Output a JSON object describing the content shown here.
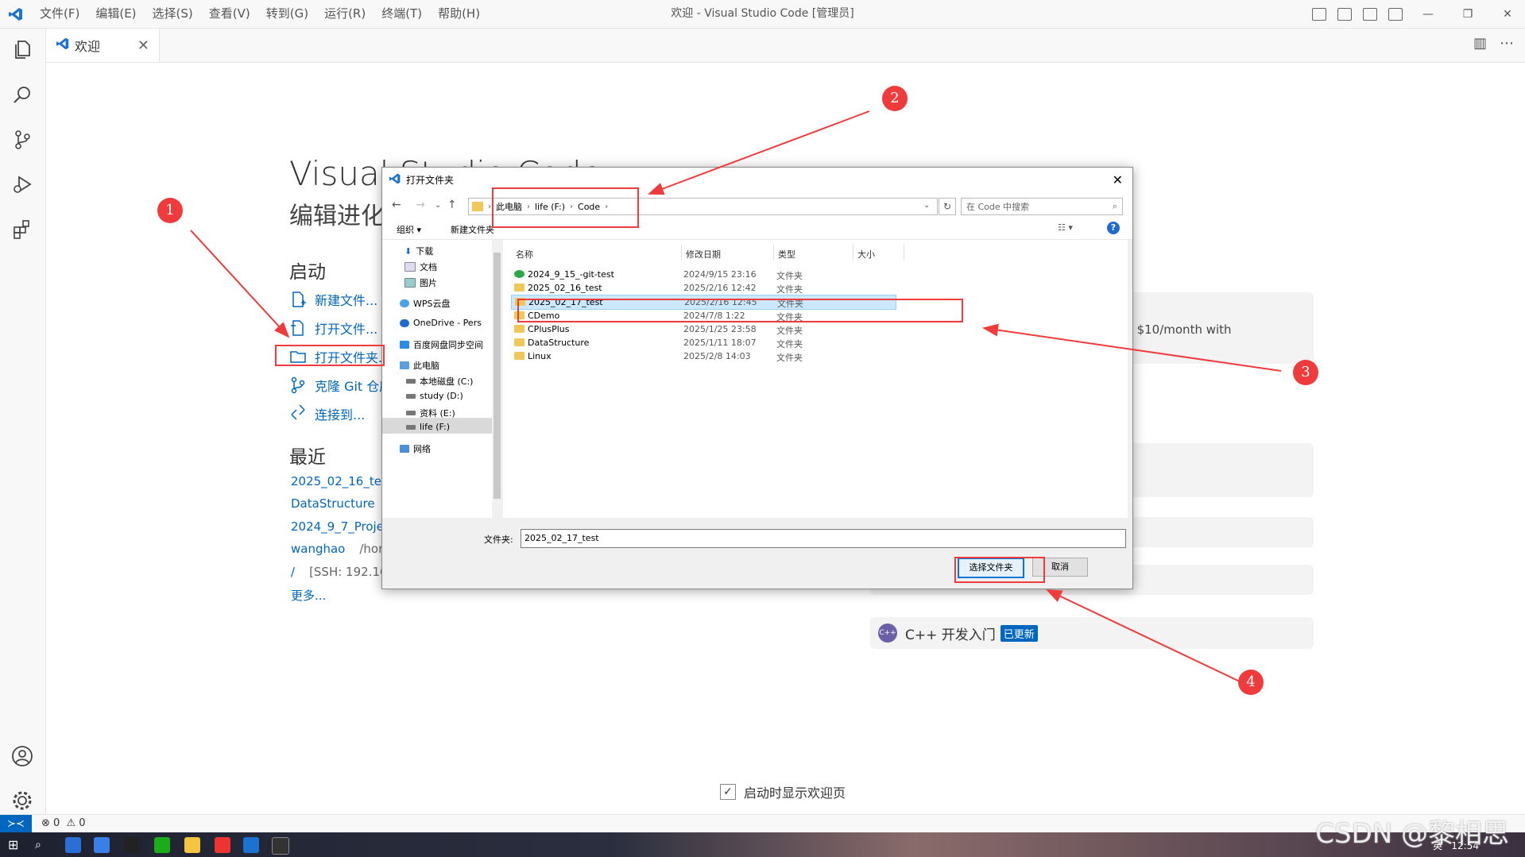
{
  "window": {
    "title": "欢迎 - Visual Studio Code [管理员]",
    "menu": [
      "文件(F)",
      "编辑(E)",
      "选择(S)",
      "查看(V)",
      "转到(G)",
      "运行(R)",
      "终端(T)",
      "帮助(H)"
    ]
  },
  "tab": {
    "label": "欢迎",
    "close": "✕"
  },
  "welcome": {
    "title": "Visual Studio Code",
    "subtitle": "编辑进化",
    "start_header": "启动",
    "start_items": [
      "新建文件...",
      "打开文件...",
      "打开文件夹...",
      "克隆 Git 仓库...",
      "连接到..."
    ],
    "recent_header": "最近",
    "recent": [
      {
        "name": "2025_02_16_test",
        "path": ""
      },
      {
        "name": "DataStructure",
        "path": ""
      },
      {
        "name": "2024_9_7_Project",
        "path": ""
      },
      {
        "name": "wanghao",
        "path": "/hor"
      },
      {
        "name": "/",
        "path": "[SSH: 192.16"
      }
    ],
    "more": "更多...",
    "card_text": "s $10/month with",
    "cpp_title": "C++ 开发入门",
    "cpp_badge": "已更新",
    "show_on_startup": "启动时显示欢迎页"
  },
  "status": {
    "errors": "0",
    "warnings": "0"
  },
  "taskbar": {
    "time": "12:54",
    "ime": "英"
  },
  "watermark": "CSDN @黎相思",
  "dialog": {
    "title": "打开文件夹",
    "close": "✕",
    "breadcrumb": [
      "此电脑",
      "life (F:)",
      "Code"
    ],
    "search_placeholder": "在 Code 中搜索",
    "toolbar": {
      "organize": "组织 ▾",
      "new_folder": "新建文件夹"
    },
    "nav": [
      "下载",
      "文档",
      "图片",
      "WPS云盘",
      "OneDrive - Pers",
      "百度网盘同步空间",
      "此电脑",
      "本地磁盘 (C:)",
      "study (D:)",
      "资料 (E:)",
      "life (F:)",
      "网络"
    ],
    "columns": [
      "名称",
      "修改日期",
      "类型",
      "大小"
    ],
    "files": [
      {
        "name": "2024_9_15_-git-test",
        "date": "2024/9/15 23:16",
        "type": "文件夹"
      },
      {
        "name": "2025_02_16_test",
        "date": "2025/2/16 12:42",
        "type": "文件夹"
      },
      {
        "name": "2025_02_17_test",
        "date": "2025/2/16 12:45",
        "type": "文件夹"
      },
      {
        "name": "CDemo",
        "date": "2024/7/8 1:22",
        "type": "文件夹"
      },
      {
        "name": "CPlusPlus",
        "date": "2025/1/25 23:58",
        "type": "文件夹"
      },
      {
        "name": "DataStructure",
        "date": "2025/1/11 18:07",
        "type": "文件夹"
      },
      {
        "name": "Linux",
        "date": "2025/2/8 14:03",
        "type": "文件夹"
      }
    ],
    "folder_label": "文件夹:",
    "folder_value": "2025_02_17_test",
    "select_button": "选择文件夹",
    "cancel_button": "取消"
  },
  "annotations": [
    "1",
    "2",
    "3",
    "4"
  ],
  "colors": {
    "accent": "#0066bf",
    "annotation": "#ef3b3b",
    "selection": "#cce8ff"
  }
}
